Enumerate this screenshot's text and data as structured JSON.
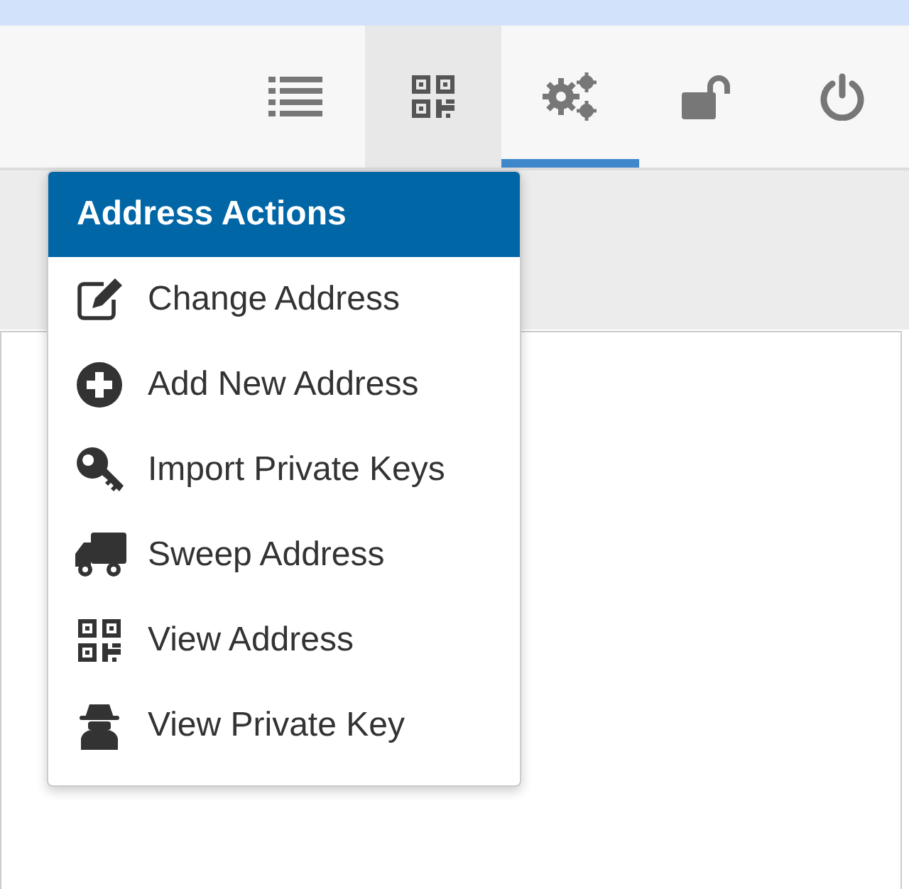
{
  "nav": [
    {
      "kind": "list",
      "selected": false,
      "open": false
    },
    {
      "kind": "qr",
      "selected": false,
      "open": true
    },
    {
      "kind": "gears",
      "selected": true,
      "open": false
    },
    {
      "kind": "unlock",
      "selected": false,
      "open": false
    },
    {
      "kind": "power",
      "selected": false,
      "open": false
    }
  ],
  "menu": {
    "title": "Address Actions",
    "items": [
      {
        "kind": "edit",
        "label": "Change Address"
      },
      {
        "kind": "plus",
        "label": "Add New Address"
      },
      {
        "kind": "key",
        "label": "Import Private Keys"
      },
      {
        "kind": "truck",
        "label": "Sweep Address"
      },
      {
        "kind": "qr",
        "label": "View Address"
      },
      {
        "kind": "spy",
        "label": "View Private Key"
      }
    ]
  }
}
